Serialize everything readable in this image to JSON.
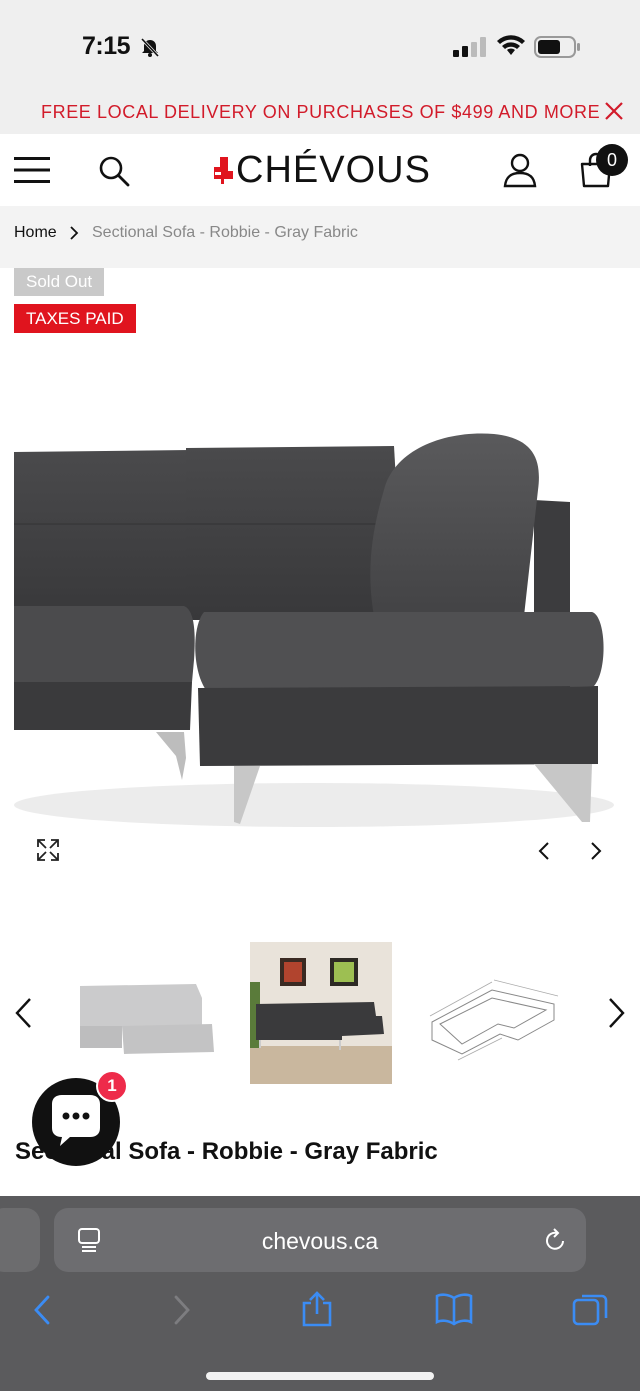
{
  "status_bar": {
    "time": "7:15",
    "icons": [
      "bell-slash-icon",
      "signal-icon",
      "wifi-icon",
      "battery-icon"
    ]
  },
  "promo": {
    "text": "FREE LOCAL DELIVERY ON PURCHASES OF $499 AND MORE",
    "color": "#d21b2a"
  },
  "header": {
    "logo_text": "CHÉVOUS",
    "cart_count": "0",
    "icons": [
      "menu-icon",
      "search-icon",
      "user-icon",
      "cart-icon"
    ]
  },
  "breadcrumb": {
    "home": "Home",
    "current": "Sectional Sofa - Robbie - Gray Fabric"
  },
  "badges": {
    "sold_out": "Sold Out",
    "taxes_paid": "TAXES PAID"
  },
  "product": {
    "title": "Sectional Sofa - Robbie - Gray Fabric",
    "visible_title": "Se      nal Sofa - Robbie - Gray Fabric",
    "thumbnails": [
      "sofa-corner-thumbnail",
      "sofa-room-thumbnail",
      "sofa-dimension-drawing-thumbnail"
    ],
    "selected_thumbnail": 2
  },
  "chat": {
    "unread_count": "1"
  },
  "browser": {
    "url": "chevous.ca"
  },
  "colors": {
    "brand_red": "#e0141e",
    "promo_red": "#d21b2a",
    "chat_badge": "#ee2b4a"
  }
}
